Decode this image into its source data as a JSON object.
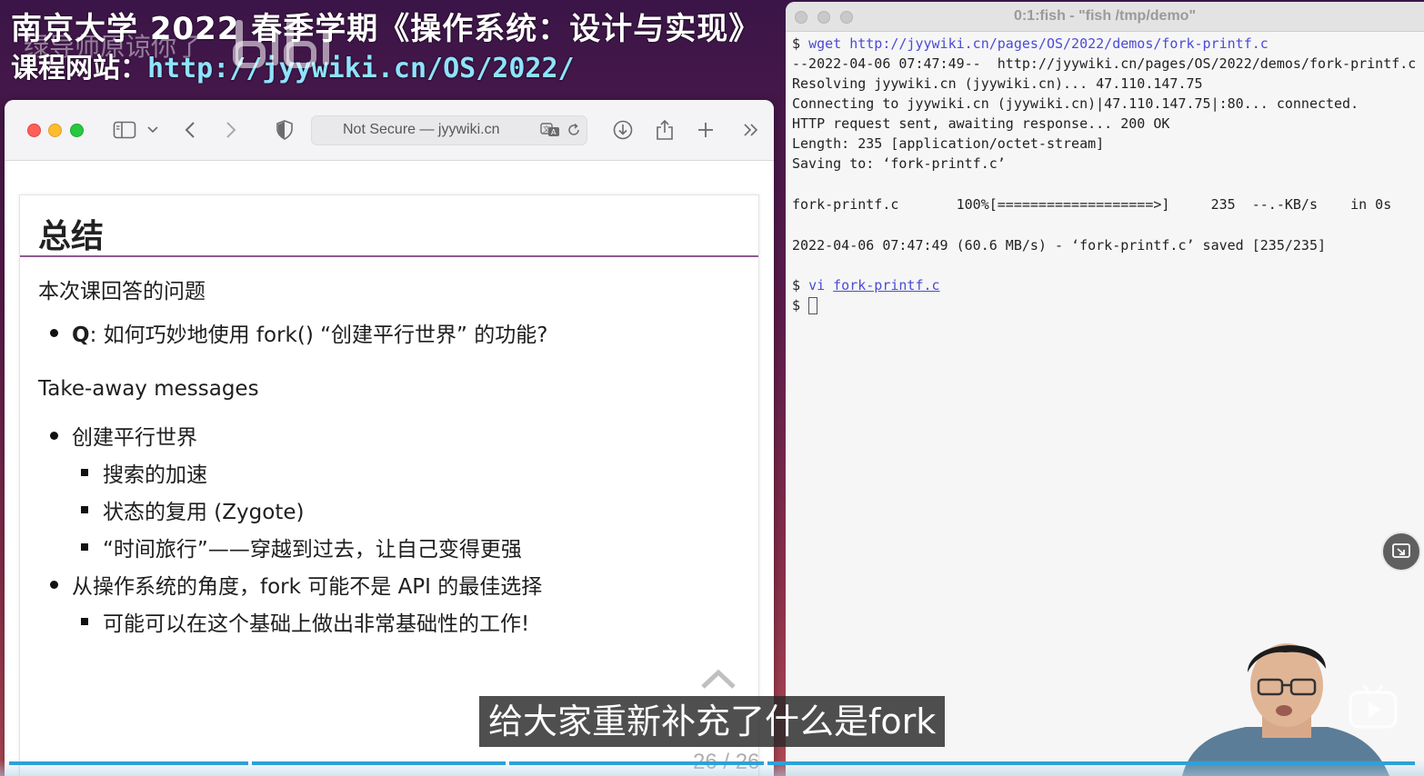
{
  "banner": {
    "title": "南京大学 2022 春季学期《操作系统：设计与实现》",
    "site_label": "课程网站：",
    "site_url": "http://jyywiki.cn/OS/2022/",
    "watermark": "绿导师原谅你了"
  },
  "browser": {
    "address": "Not Secure — jyywiki.cn"
  },
  "slide": {
    "heading": "总结",
    "subheading_1": "本次课回答的问题",
    "q_label": "Q",
    "q_text": ": 如何巧妙地使用 fork() “创建平行世界” 的功能?",
    "subheading_2": "Take-away messages",
    "bullet_1": "创建平行世界",
    "bullet_1_sub": [
      "搜索的加速",
      "状态的复用 (Zygote)",
      "“时间旅行”——穿越到过去，让自己变得更强"
    ],
    "bullet_2": "从操作系统的角度，fork 可能不是 API 的最佳选择",
    "bullet_2_sub": [
      "可能可以在这个基础上做出非常基础性的工作!"
    ],
    "page_number": "26 / 26"
  },
  "terminal": {
    "title": "0:1:fish - \"fish /tmp/demo\"",
    "prompt": "$",
    "cmd1_name": "wget",
    "cmd1_arg": "http://jyywiki.cn/pages/OS/2022/demos/fork-printf.c",
    "out": [
      "--2022-04-06 07:47:49--  http://jyywiki.cn/pages/OS/2022/demos/fork-printf.c",
      "Resolving jyywiki.cn (jyywiki.cn)... 47.110.147.75",
      "Connecting to jyywiki.cn (jyywiki.cn)|47.110.147.75|:80... connected.",
      "HTTP request sent, awaiting response... 200 OK",
      "Length: 235 [application/octet-stream]",
      "Saving to: ‘fork-printf.c’",
      "fork-printf.c       100%[===================>]     235  --.-KB/s    in 0s",
      "2022-04-06 07:47:49 (60.6 MB/s) - ‘fork-printf.c’ saved [235/235]"
    ],
    "cmd2_name": "vi",
    "cmd2_arg": "fork-printf.c"
  },
  "overlay": {
    "subtitle": "给大家重新补充了什么是fork"
  },
  "icons": {
    "pip": "picture-in-picture-icon",
    "tv": "bilibili-tv-icon"
  },
  "progress": {
    "played_fraction": 1.0
  }
}
